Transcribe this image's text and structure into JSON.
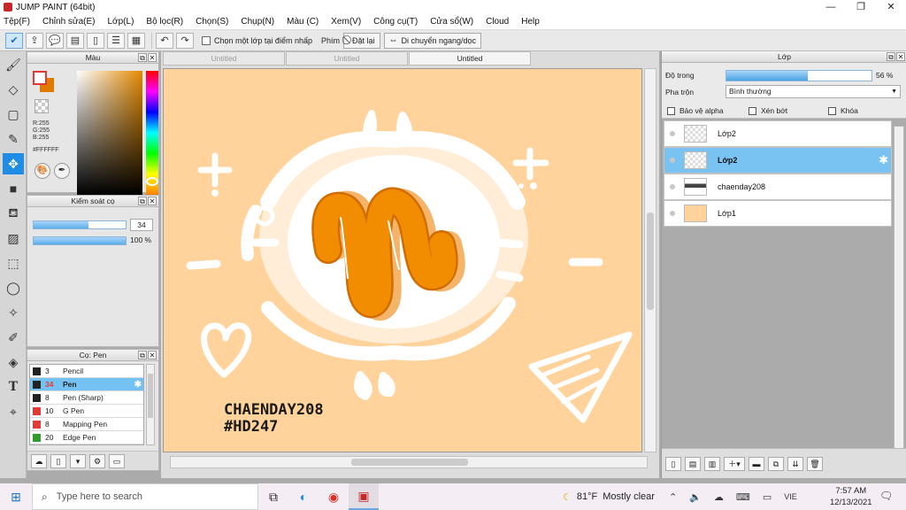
{
  "window": {
    "title": "JUMP PAINT (64bit)",
    "controls": [
      "—",
      "❐",
      "✕"
    ]
  },
  "menu": [
    "Tệp(F)",
    "Chỉnh sửa(E)",
    "Lớp(L)",
    "Bộ lọc(R)",
    "Chọn(S)",
    "Chụp(N)",
    "Màu (C)",
    "Xem(V)",
    "Công cụ(T)",
    "Cửa sổ(W)",
    "Cloud",
    "Help"
  ],
  "toolbar": {
    "select_layer_label": "Chọn một lớp tại điểm nhấp",
    "key_label": "Phím",
    "reset_label": "Đặt lại",
    "move_label": "Di chuyển ngang/dọc"
  },
  "color_panel": {
    "title": "Màu",
    "r": "R:255",
    "g": "G:255",
    "b": "B:255",
    "hex": "#FFFFFF"
  },
  "brush_control": {
    "title": "Kiểm soát cọ",
    "size_value": "34",
    "size_fraction": 0.6,
    "opacity_value": "100 %",
    "opacity_fraction": 1.0
  },
  "brush_panel": {
    "title": "Cọ: Pen",
    "items": [
      {
        "size": "3",
        "name": "Pencil",
        "color": "#222222",
        "selected": false
      },
      {
        "size": "34",
        "name": "Pen",
        "color": "#222222",
        "selected": true
      },
      {
        "size": "8",
        "name": "Pen (Sharp)",
        "color": "#222222",
        "selected": false
      },
      {
        "size": "10",
        "name": "G Pen",
        "color": "#e53935",
        "selected": false
      },
      {
        "size": "8",
        "name": "Mapping Pen",
        "color": "#e53935",
        "selected": false
      },
      {
        "size": "20",
        "name": "Edge Pen",
        "color": "#2e9d2e",
        "selected": false
      }
    ]
  },
  "documents": {
    "tabs": [
      "Untitled",
      "Untitled",
      "Untitled"
    ],
    "active_index": 2
  },
  "canvas": {
    "background": "#ffd39b",
    "caption_line1": "CHAENDAY208",
    "caption_line2": "#HD247"
  },
  "layer_panel": {
    "title": "Lớp",
    "opacity_label": "Độ trong",
    "opacity_value": "56 %",
    "opacity_fraction": 0.56,
    "blend_label": "Pha trộn",
    "blend_value": "Bình thường",
    "protect_alpha": "Bảo vệ alpha",
    "clipping": "Xén bớt",
    "lock": "Khóa",
    "layers": [
      {
        "name": "Lớp2",
        "selected": false
      },
      {
        "name": "Lớp2",
        "selected": true
      },
      {
        "name": "chaenday208",
        "selected": false
      },
      {
        "name": "Lớp1",
        "selected": false
      }
    ]
  },
  "taskbar": {
    "search_placeholder": "Type here to search",
    "temperature": "81°F",
    "weather": "Mostly clear",
    "language": "VIE",
    "time": "7:57 AM",
    "date": "12/13/2021"
  },
  "colors": {
    "accent": "#1f8ce6",
    "selection": "#79c3f2",
    "art_orange": "#f28c00"
  }
}
